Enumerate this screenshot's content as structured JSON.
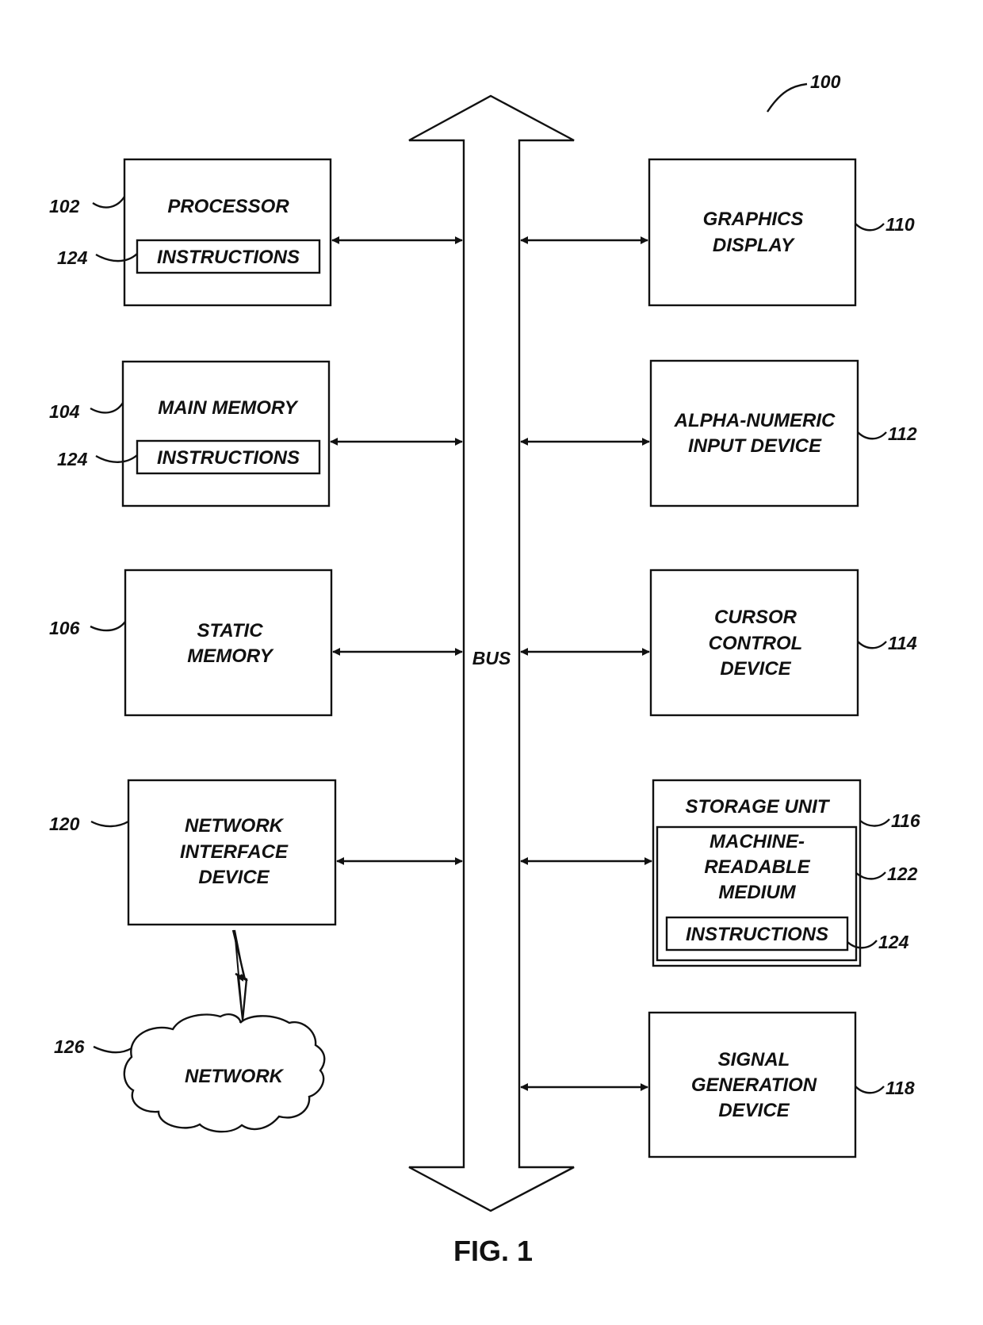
{
  "figure": {
    "ref": "100",
    "caption": "FIG. 1",
    "bus_label": "BUS"
  },
  "left_components": [
    {
      "ref": "102",
      "lines": [
        "PROCESSOR"
      ],
      "inner": {
        "ref": "124",
        "label": "INSTRUCTIONS"
      }
    },
    {
      "ref": "104",
      "lines": [
        "MAIN MEMORY"
      ],
      "inner": {
        "ref": "124",
        "label": "INSTRUCTIONS"
      }
    },
    {
      "ref": "106",
      "lines": [
        "STATIC",
        "MEMORY"
      ]
    },
    {
      "ref": "120",
      "lines": [
        "NETWORK",
        "INTERFACE",
        "DEVICE"
      ]
    }
  ],
  "network": {
    "ref": "126",
    "label": "NETWORK"
  },
  "right_components": [
    {
      "ref": "110",
      "lines": [
        "GRAPHICS",
        "DISPLAY"
      ]
    },
    {
      "ref": "112",
      "lines": [
        "ALPHA-NUMERIC",
        "INPUT DEVICE"
      ]
    },
    {
      "ref": "114",
      "lines": [
        "CURSOR",
        "CONTROL",
        "DEVICE"
      ]
    },
    {
      "ref": "116",
      "lines": [
        "STORAGE UNIT"
      ],
      "medium": {
        "ref": "122",
        "lines": [
          "MACHINE-",
          "READABLE",
          "MEDIUM"
        ]
      },
      "inner": {
        "ref": "124",
        "label": "INSTRUCTIONS"
      }
    },
    {
      "ref": "118",
      "lines": [
        "SIGNAL",
        "GENERATION",
        "DEVICE"
      ]
    }
  ]
}
